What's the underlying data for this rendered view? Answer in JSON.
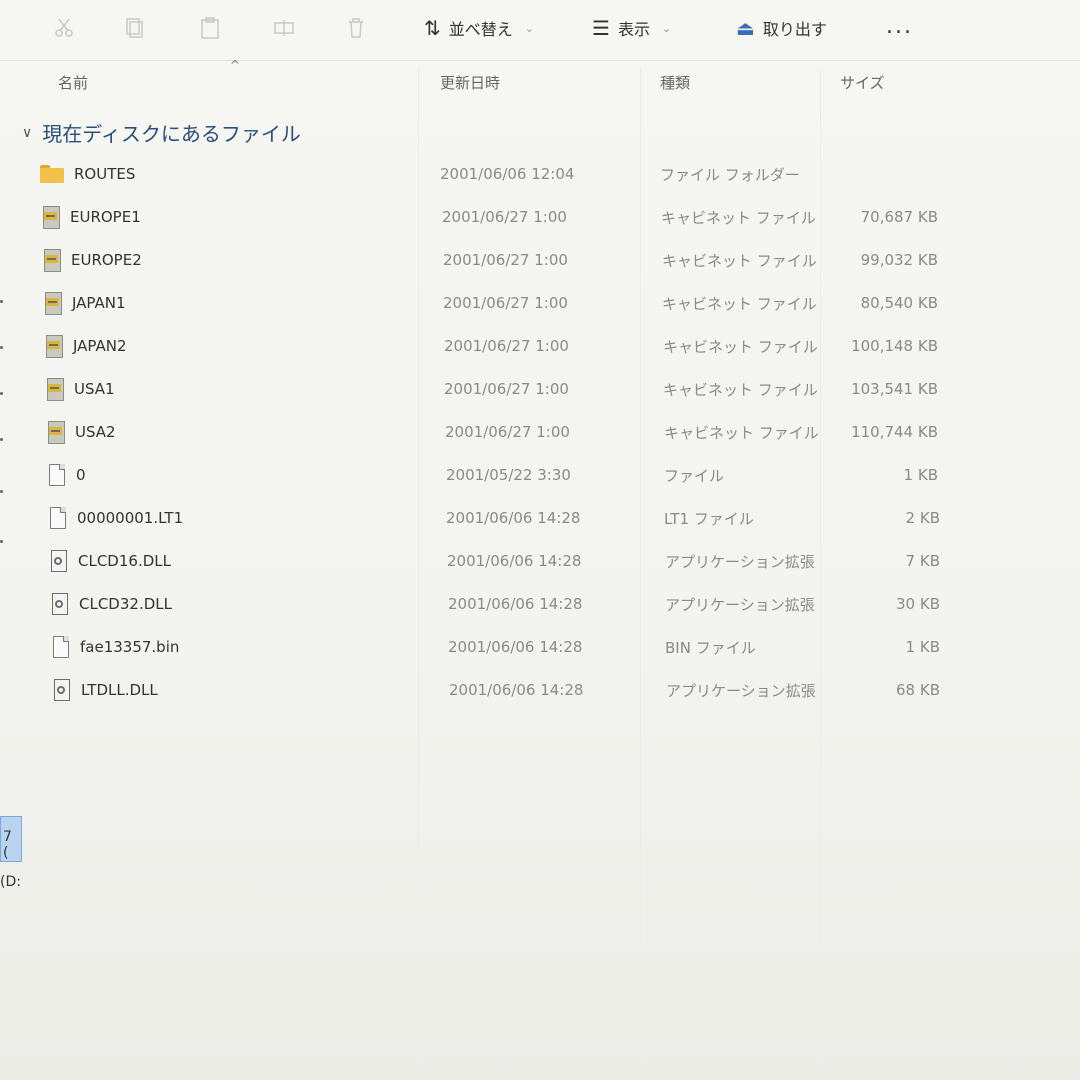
{
  "toolbar": {
    "sort_label": "並べ替え",
    "view_label": "表示",
    "eject_label": "取り出す",
    "more_label": "...",
    "icons": [
      "cut-icon",
      "copy-icon",
      "paste-icon",
      "rename-icon",
      "share-icon",
      "delete-icon"
    ]
  },
  "columns": {
    "name": "名前",
    "date": "更新日時",
    "type": "種類",
    "size": "サイズ"
  },
  "group": {
    "label": "現在ディスクにあるファイル"
  },
  "files": [
    {
      "name": "ROUTES",
      "date": "2001/06/06 12:04",
      "type": "ファイル フォルダー",
      "size": "",
      "icon": "folder-icon"
    },
    {
      "name": "EUROPE1",
      "date": "2001/06/27 1:00",
      "type": "キャビネット ファイル",
      "size": "70,687 KB",
      "icon": "cabinet-icon"
    },
    {
      "name": "EUROPE2",
      "date": "2001/06/27 1:00",
      "type": "キャビネット ファイル",
      "size": "99,032 KB",
      "icon": "cabinet-icon"
    },
    {
      "name": "JAPAN1",
      "date": "2001/06/27 1:00",
      "type": "キャビネット ファイル",
      "size": "80,540 KB",
      "icon": "cabinet-icon"
    },
    {
      "name": "JAPAN2",
      "date": "2001/06/27 1:00",
      "type": "キャビネット ファイル",
      "size": "100,148 KB",
      "icon": "cabinet-icon"
    },
    {
      "name": "USA1",
      "date": "2001/06/27 1:00",
      "type": "キャビネット ファイル",
      "size": "103,541 KB",
      "icon": "cabinet-icon"
    },
    {
      "name": "USA2",
      "date": "2001/06/27 1:00",
      "type": "キャビネット ファイル",
      "size": "110,744 KB",
      "icon": "cabinet-icon"
    },
    {
      "name": "0",
      "date": "2001/05/22 3:30",
      "type": "ファイル",
      "size": "1 KB",
      "icon": "file-icon"
    },
    {
      "name": "00000001.LT1",
      "date": "2001/06/06 14:28",
      "type": "LT1 ファイル",
      "size": "2 KB",
      "icon": "file-icon"
    },
    {
      "name": "CLCD16.DLL",
      "date": "2001/06/06 14:28",
      "type": "アプリケーション拡張",
      "size": "7 KB",
      "icon": "dll-icon"
    },
    {
      "name": "CLCD32.DLL",
      "date": "2001/06/06 14:28",
      "type": "アプリケーション拡張",
      "size": "30 KB",
      "icon": "dll-icon"
    },
    {
      "name": "fae13357.bin",
      "date": "2001/06/06 14:28",
      "type": "BIN ファイル",
      "size": "1 KB",
      "icon": "file-icon"
    },
    {
      "name": "LTDLL.DLL",
      "date": "2001/06/06 14:28",
      "type": "アプリケーション拡張",
      "size": "68 KB",
      "icon": "dll-icon"
    }
  ],
  "nav": {
    "frag1": "7 (",
    "frag2": "(D:"
  }
}
